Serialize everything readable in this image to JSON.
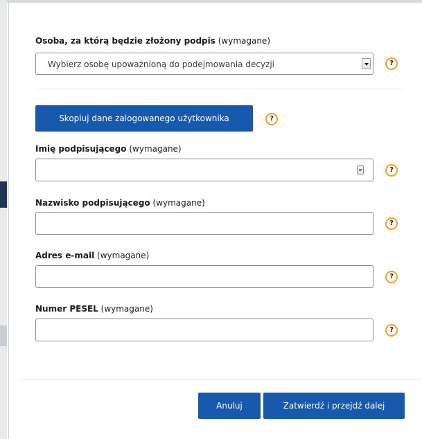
{
  "form": {
    "signer_select": {
      "label": "Osoba, za którą będzie złożony podpis",
      "required": "(wymagane)",
      "selected": "Wybierz osobę upoważnioną do podejmowania decyzji"
    },
    "copy_button": "Skopiuj dane zalogowanego użytkownika",
    "first_name": {
      "label": "Imię podpisującego",
      "required": "(wymagane)",
      "value": ""
    },
    "last_name": {
      "label": "Nazwisko podpisującego",
      "required": "(wymagane)",
      "value": ""
    },
    "email": {
      "label": "Adres e-mail",
      "required": "(wymagane)",
      "value": ""
    },
    "pesel": {
      "label": "Numer PESEL",
      "required": "(wymagane)",
      "value": ""
    },
    "help_glyph": "?"
  },
  "footer": {
    "cancel_label": "Anuluj",
    "submit_label": "Zatwierdź i przejdź dalej"
  },
  "colors": {
    "primary": "#1659ad",
    "help_ring": "#f0a020"
  },
  "icons": [
    "chevron-down-icon",
    "help-icon",
    "keyboard-icon"
  ]
}
